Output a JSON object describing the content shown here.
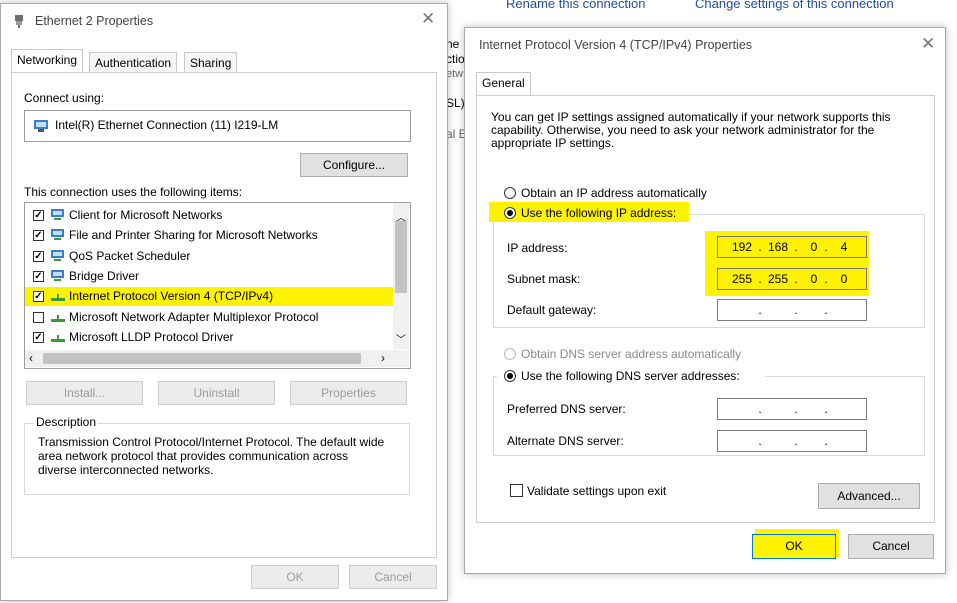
{
  "background_toolbar": {
    "links": [
      "Rename this connection",
      "Change settings of this connection"
    ],
    "partial_text": [
      "ne",
      "ctio",
      "etw",
      "SL)",
      "al E"
    ]
  },
  "eth_dialog": {
    "title": "Ethernet 2 Properties",
    "tabs": [
      "Networking",
      "Authentication",
      "Sharing"
    ],
    "connect_using_label": "Connect using:",
    "adapter": "Intel(R) Ethernet Connection (11) I219-LM",
    "configure_button": "Configure...",
    "items_label": "This connection uses the following items:",
    "items": [
      {
        "label": "Client for Microsoft Networks",
        "checked": true,
        "icon": "network-client-icon"
      },
      {
        "label": "File and Printer Sharing for Microsoft Networks",
        "checked": true,
        "icon": "network-service-icon"
      },
      {
        "label": "QoS Packet Scheduler",
        "checked": true,
        "icon": "network-service-icon"
      },
      {
        "label": "Bridge Driver",
        "checked": true,
        "icon": "network-service-icon"
      },
      {
        "label": "Internet Protocol Version 4 (TCP/IPv4)",
        "checked": true,
        "icon": "protocol-icon",
        "highlighted": true
      },
      {
        "label": "Microsoft Network Adapter Multiplexor Protocol",
        "checked": false,
        "icon": "protocol-icon"
      },
      {
        "label": "Microsoft LLDP Protocol Driver",
        "checked": true,
        "icon": "protocol-icon"
      }
    ],
    "install_button": "Install...",
    "uninstall_button": "Uninstall",
    "properties_button": "Properties",
    "description_label": "Description",
    "description_text": "Transmission Control Protocol/Internet Protocol. The default wide area network protocol that provides communication across diverse interconnected networks.",
    "ok_button": "OK",
    "cancel_button": "Cancel"
  },
  "ipv4_dialog": {
    "title": "Internet Protocol Version 4 (TCP/IPv4) Properties",
    "tab": "General",
    "intro": "You can get IP settings assigned automatically if your network supports this capability. Otherwise, you need to ask your network administrator for the appropriate IP settings.",
    "obtain_ip_auto": "Obtain an IP address automatically",
    "use_following_ip": "Use the following IP address:",
    "ip_address_label": "IP address:",
    "ip_address": [
      "192",
      "168",
      "0",
      "4"
    ],
    "subnet_mask_label": "Subnet mask:",
    "subnet_mask": [
      "255",
      "255",
      "0",
      "0"
    ],
    "default_gateway_label": "Default gateway:",
    "default_gateway": [
      "",
      "",
      "",
      ""
    ],
    "obtain_dns_auto": "Obtain DNS server address automatically",
    "use_following_dns": "Use the following DNS server addresses:",
    "preferred_dns_label": "Preferred DNS server:",
    "preferred_dns": [
      "",
      "",
      "",
      ""
    ],
    "alternate_dns_label": "Alternate DNS server:",
    "alternate_dns": [
      "",
      "",
      "",
      ""
    ],
    "validate_label": "Validate settings upon exit",
    "advanced_button": "Advanced...",
    "ok_button": "OK",
    "cancel_button": "Cancel"
  },
  "colors": {
    "highlight": "#fff200",
    "link": "#1e4f9c"
  }
}
